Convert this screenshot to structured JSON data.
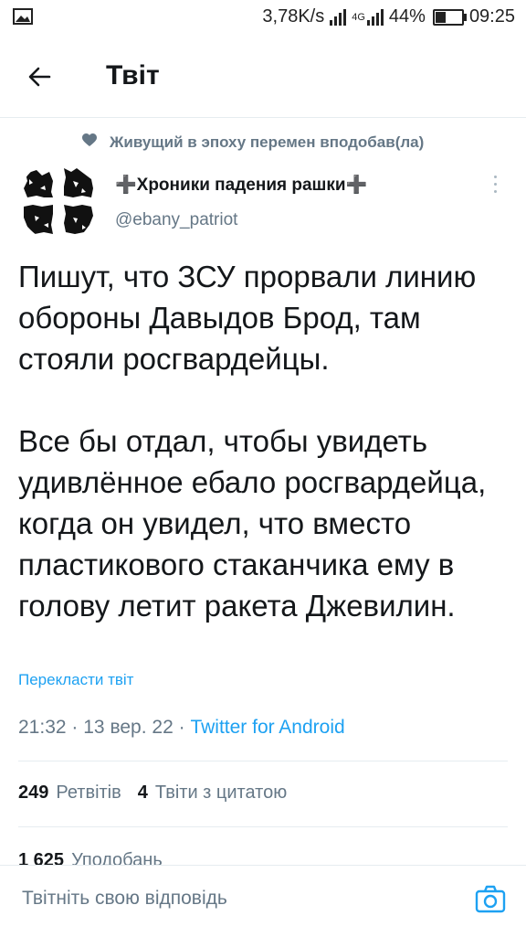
{
  "status_bar": {
    "speed": "3,78K/s",
    "network": "4G",
    "battery": "44%",
    "battery_level": 0.44,
    "time": "09:25"
  },
  "header": {
    "title": "Твіт"
  },
  "tweet": {
    "liked_by": "Живущий в эпоху перемен вподобав(ла)",
    "author_name": "➕Хроники падения рашки➕",
    "author_handle": "@ebany_patriot",
    "paragraph1": "Пишут, что ЗСУ прорвали линию обороны Давыдов Брод, там стояли росгвардейцы.",
    "paragraph2": "Все бы отдал, чтобы увидеть удивлённое ебало росгвардейца, когда он увидел, что вместо пластикового стаканчика ему в голову летит ракета Джевилин.",
    "translate_label": "Перекласти твіт",
    "time": "21:32",
    "date": "13 вер. 22",
    "separator": "·",
    "source": "Twitter for Android"
  },
  "stats": {
    "retweets_count": "249",
    "retweets_label": "Ретвітів",
    "quotes_count": "4",
    "quotes_label": "Твіти з цитатою",
    "likes_count": "1 625",
    "likes_label": "Уподобань"
  },
  "reply": {
    "placeholder": "Твітніть свою відповідь"
  },
  "colors": {
    "accent": "#1da1f2",
    "secondary_text": "#657786",
    "divider": "#e6ecf0"
  }
}
